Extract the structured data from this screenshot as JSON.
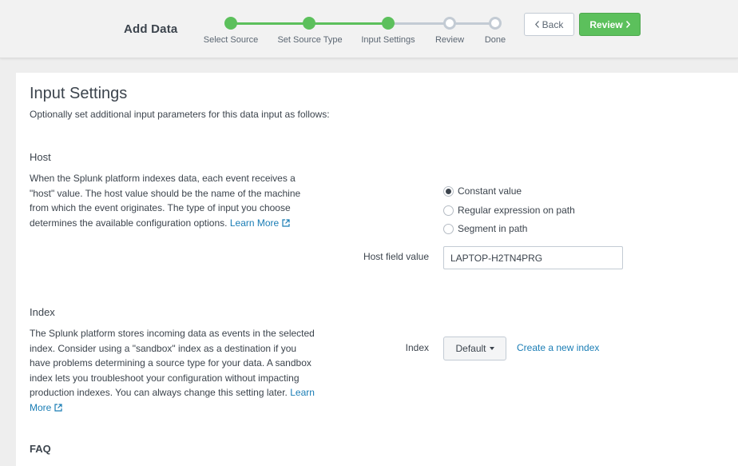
{
  "header": {
    "title": "Add Data",
    "steps": [
      {
        "label": "Select Source",
        "status": "done"
      },
      {
        "label": "Set Source Type",
        "status": "done"
      },
      {
        "label": "Input Settings",
        "status": "done"
      },
      {
        "label": "Review",
        "status": "todo"
      },
      {
        "label": "Done",
        "status": "todo"
      }
    ],
    "back_label": "Back",
    "review_label": "Review"
  },
  "colors": {
    "accent_green": "#5cc05c",
    "link_blue": "#1a7db5",
    "pending_gray": "#c3cbd4"
  },
  "page": {
    "title": "Input Settings",
    "subtitle": "Optionally set additional input parameters for this data input as follows:"
  },
  "host": {
    "heading": "Host",
    "description": "When the Splunk platform indexes data, each event receives a \"host\" value. The host value should be the name of the machine from which the event originates. The type of input you choose determines the available configuration options.",
    "learn_more": "Learn More",
    "options": [
      "Constant value",
      "Regular expression on path",
      "Segment in path"
    ],
    "selected_option": "Constant value",
    "field_label": "Host field value",
    "field_value": "LAPTOP-H2TN4PRG"
  },
  "index": {
    "heading": "Index",
    "description": "The Splunk platform stores incoming data as events in the selected index. Consider using a \"sandbox\" index as a destination if you have problems determining a source type for your data. A sandbox index lets you troubleshoot your configuration without impacting production indexes. You can always change this setting later.",
    "learn_more": "Learn More",
    "field_label": "Index",
    "selected": "Default",
    "create_link": "Create a new index"
  },
  "faq": {
    "heading": "FAQ"
  }
}
